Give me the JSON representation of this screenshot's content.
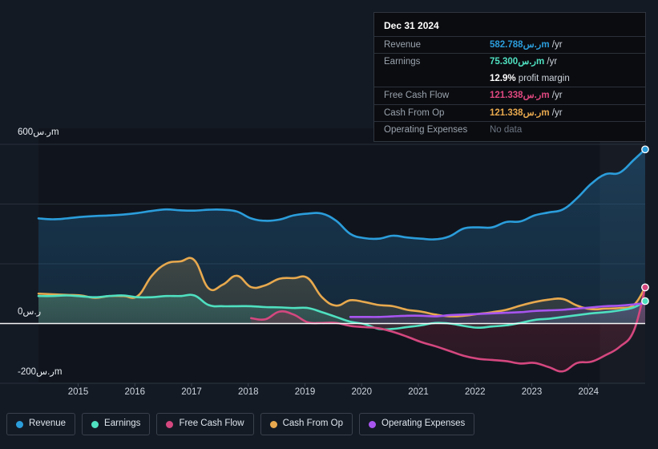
{
  "theme": {
    "background": "#141a24",
    "plot_background": "#10151d",
    "gridline": "#2c3540",
    "zero_line": "#ffffff",
    "axis_text": "#e8edf2"
  },
  "tooltip": {
    "date": "Dec 31 2024",
    "rows": [
      {
        "key": "Revenue",
        "value": "582.788ر.سm",
        "unit": " /yr",
        "color": "#2b9ddb",
        "no_data": false
      },
      {
        "key": "Earnings",
        "value": "75.300ر.سm",
        "unit": " /yr",
        "color": "#4fe0c0",
        "no_data": false
      },
      {
        "key": "",
        "value": "12.9%",
        "unit": " profit margin",
        "color": "#ffffff",
        "no_data": false
      },
      {
        "key": "Free Cash Flow",
        "value": "121.338ر.سm",
        "unit": " /yr",
        "color": "#e0487f",
        "no_data": false
      },
      {
        "key": "Cash From Op",
        "value": "121.338ر.سm",
        "unit": " /yr",
        "color": "#e8a94e",
        "no_data": false
      },
      {
        "key": "Operating Expenses",
        "value": "No data",
        "unit": "",
        "color": "#6b7480",
        "no_data": true
      }
    ]
  },
  "y_axis": {
    "labels": [
      "600ر.سm",
      "0ر.س",
      "-200ر.سm"
    ],
    "values": [
      600,
      0,
      -200
    ],
    "top_value": 600,
    "bottom_value": -200
  },
  "x_axis": {
    "labels": [
      "2015",
      "2016",
      "2017",
      "2018",
      "2019",
      "2020",
      "2021",
      "2022",
      "2023",
      "2024"
    ]
  },
  "legend": {
    "items": [
      {
        "label": "Revenue",
        "color": "#2b9ddb"
      },
      {
        "label": "Earnings",
        "color": "#4fe0c0"
      },
      {
        "label": "Free Cash Flow",
        "color": "#d4477f"
      },
      {
        "label": "Cash From Op",
        "color": "#e8a94e"
      },
      {
        "label": "Operating Expenses",
        "color": "#a855f0"
      }
    ]
  },
  "chart_data": {
    "type": "area",
    "title": "",
    "xlabel": "",
    "ylabel": "",
    "ylim": [
      -200,
      600
    ],
    "xlim": [
      "2014.3",
      "2025.0"
    ],
    "grid": true,
    "legend_position": "bottom-left",
    "currency_suffix": "ر.سm",
    "period": "/yr",
    "gridline_values": [
      600,
      400,
      200,
      0,
      -200
    ],
    "forecast_band_start": "2024.2",
    "x": [
      2014.3,
      2014.55,
      2014.8,
      2015.05,
      2015.3,
      2015.55,
      2015.8,
      2016.05,
      2016.3,
      2016.55,
      2016.8,
      2017.05,
      2017.3,
      2017.55,
      2017.8,
      2018.05,
      2018.3,
      2018.55,
      2018.8,
      2019.05,
      2019.3,
      2019.55,
      2019.8,
      2020.05,
      2020.3,
      2020.55,
      2020.8,
      2021.05,
      2021.3,
      2021.55,
      2021.8,
      2022.05,
      2022.3,
      2022.55,
      2022.8,
      2023.05,
      2023.3,
      2023.55,
      2023.8,
      2024.05,
      2024.3,
      2024.55,
      2024.8,
      2025.0
    ],
    "series": [
      {
        "name": "Revenue",
        "color": "#2b9ddb",
        "fill": "rgba(35,105,155,0.42)",
        "values": [
          352,
          349,
          352,
          357,
          360,
          362,
          365,
          370,
          377,
          382,
          379,
          378,
          381,
          381,
          375,
          352,
          344,
          348,
          362,
          368,
          368,
          344,
          300,
          286,
          284,
          294,
          288,
          284,
          282,
          292,
          318,
          322,
          322,
          340,
          342,
          362,
          372,
          382,
          420,
          468,
          500,
          505,
          548,
          583
        ]
      },
      {
        "name": "Earnings",
        "color": "#4fe0c0",
        "fill": "rgba(79,224,192,0.20)",
        "values": [
          92,
          92,
          94,
          91,
          88,
          92,
          94,
          88,
          88,
          92,
          92,
          94,
          62,
          58,
          58,
          58,
          55,
          54,
          52,
          52,
          38,
          22,
          6,
          -2,
          -18,
          -18,
          -12,
          -6,
          2,
          0,
          -8,
          -14,
          -10,
          -6,
          2,
          12,
          16,
          22,
          28,
          34,
          38,
          44,
          54,
          75
        ]
      },
      {
        "name": "Free Cash Flow",
        "color": "#d4477f",
        "fill": "rgba(160,40,70,0.30)",
        "start_index": 15,
        "values": [
          null,
          null,
          null,
          null,
          null,
          null,
          null,
          null,
          null,
          null,
          null,
          null,
          null,
          null,
          null,
          18,
          14,
          40,
          30,
          4,
          2,
          2,
          -8,
          -12,
          -16,
          -28,
          -44,
          -62,
          -76,
          -92,
          -108,
          -118,
          -122,
          -126,
          -134,
          -132,
          -146,
          -160,
          -132,
          -128,
          -106,
          -78,
          -24,
          121
        ]
      },
      {
        "name": "Cash From Op",
        "color": "#e8a94e",
        "fill": "rgba(120,105,70,0.42)",
        "values": [
          100,
          98,
          96,
          94,
          86,
          92,
          92,
          92,
          160,
          200,
          208,
          212,
          118,
          130,
          160,
          122,
          128,
          150,
          152,
          152,
          88,
          60,
          78,
          72,
          62,
          58,
          46,
          40,
          30,
          24,
          26,
          32,
          38,
          46,
          60,
          72,
          80,
          82,
          60,
          48,
          50,
          52,
          62,
          121
        ]
      },
      {
        "name": "Operating Expenses",
        "color": "#a855f0",
        "fill": "rgba(120,60,170,0.32)",
        "start_index": 22,
        "values": [
          null,
          null,
          null,
          null,
          null,
          null,
          null,
          null,
          null,
          null,
          null,
          null,
          null,
          null,
          null,
          null,
          null,
          null,
          null,
          null,
          null,
          null,
          22,
          22,
          22,
          24,
          26,
          26,
          24,
          28,
          30,
          32,
          34,
          36,
          38,
          42,
          44,
          46,
          50,
          54,
          58,
          60,
          64,
          68
        ]
      }
    ],
    "endpoints": [
      {
        "series": "Revenue",
        "value": 583,
        "color": "#2b9ddb"
      },
      {
        "series": "Cash From Op",
        "value": 121,
        "color": "#e8a94e"
      },
      {
        "series": "Earnings",
        "value": 75,
        "color": "#4fe0c0"
      },
      {
        "series": "Free Cash Flow",
        "value": 121,
        "color": "#d4477f"
      }
    ]
  }
}
